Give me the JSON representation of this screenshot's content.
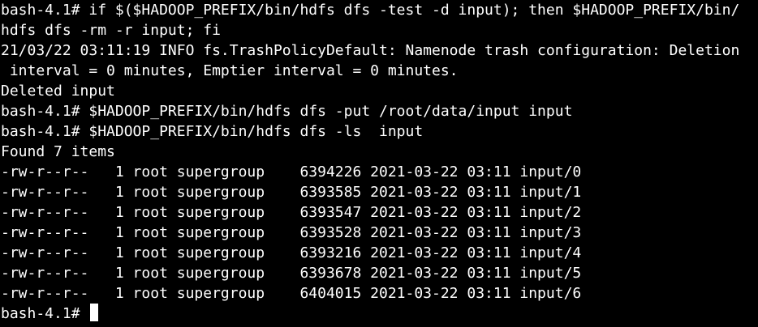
{
  "terminal": {
    "prompt": "bash-4.1# ",
    "lines": [
      "bash-4.1# if $($HADOOP_PREFIX/bin/hdfs dfs -test -d input); then $HADOOP_PREFIX/bin/",
      "hdfs dfs -rm -r input; fi",
      "21/03/22 03:11:19 INFO fs.TrashPolicyDefault: Namenode trash configuration: Deletion",
      " interval = 0 minutes, Emptier interval = 0 minutes.",
      "Deleted input",
      "bash-4.1# $HADOOP_PREFIX/bin/hdfs dfs -put /root/data/input input",
      "bash-4.1# $HADOOP_PREFIX/bin/hdfs dfs -ls  input",
      "Found 7 items",
      "-rw-r--r--   1 root supergroup    6394226 2021-03-22 03:11 input/0",
      "-rw-r--r--   1 root supergroup    6393585 2021-03-22 03:11 input/1",
      "-rw-r--r--   1 root supergroup    6393547 2021-03-22 03:11 input/2",
      "-rw-r--r--   1 root supergroup    6393528 2021-03-22 03:11 input/3",
      "-rw-r--r--   1 root supergroup    6393216 2021-03-22 03:11 input/4",
      "-rw-r--r--   1 root supergroup    6393678 2021-03-22 03:11 input/5",
      "-rw-r--r--   1 root supergroup    6404015 2021-03-22 03:11 input/6"
    ],
    "colors": {
      "background": "#000000",
      "foreground": "#ffffff"
    }
  }
}
